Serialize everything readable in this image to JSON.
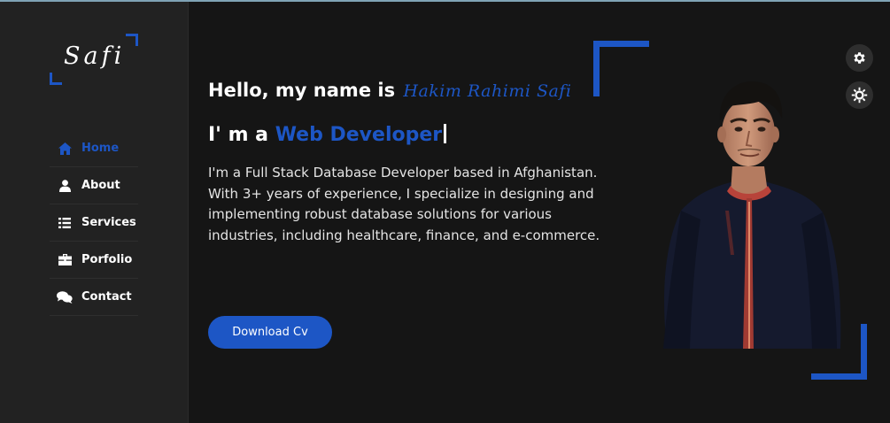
{
  "logo": {
    "text": "Safi"
  },
  "nav": {
    "items": [
      {
        "label": "Home",
        "icon": "home-icon",
        "active": true
      },
      {
        "label": "About",
        "icon": "user-icon",
        "active": false
      },
      {
        "label": "Services",
        "icon": "list-icon",
        "active": false
      },
      {
        "label": "Porfolio",
        "icon": "briefcase-icon",
        "active": false
      },
      {
        "label": "Contact",
        "icon": "chat-icon",
        "active": false
      }
    ]
  },
  "hero": {
    "greeting": "Hello, my name is",
    "name": "Hakim Rahimi Safi",
    "role_prefix": "I' m a",
    "role": "Web Developer",
    "description": "I'm a Full Stack Database Developer based in Afghanistan. With 3+ years of experience, I specialize in designing and implementing robust database solutions for various industries, including healthcare, finance, and e-commerce.",
    "download_label": "Download Cv"
  },
  "settings": {
    "icons": [
      "gear-icon",
      "sun-gear-icon"
    ]
  },
  "colors": {
    "accent": "#1d56c5",
    "background": "#151515",
    "sidebar": "#222222"
  }
}
